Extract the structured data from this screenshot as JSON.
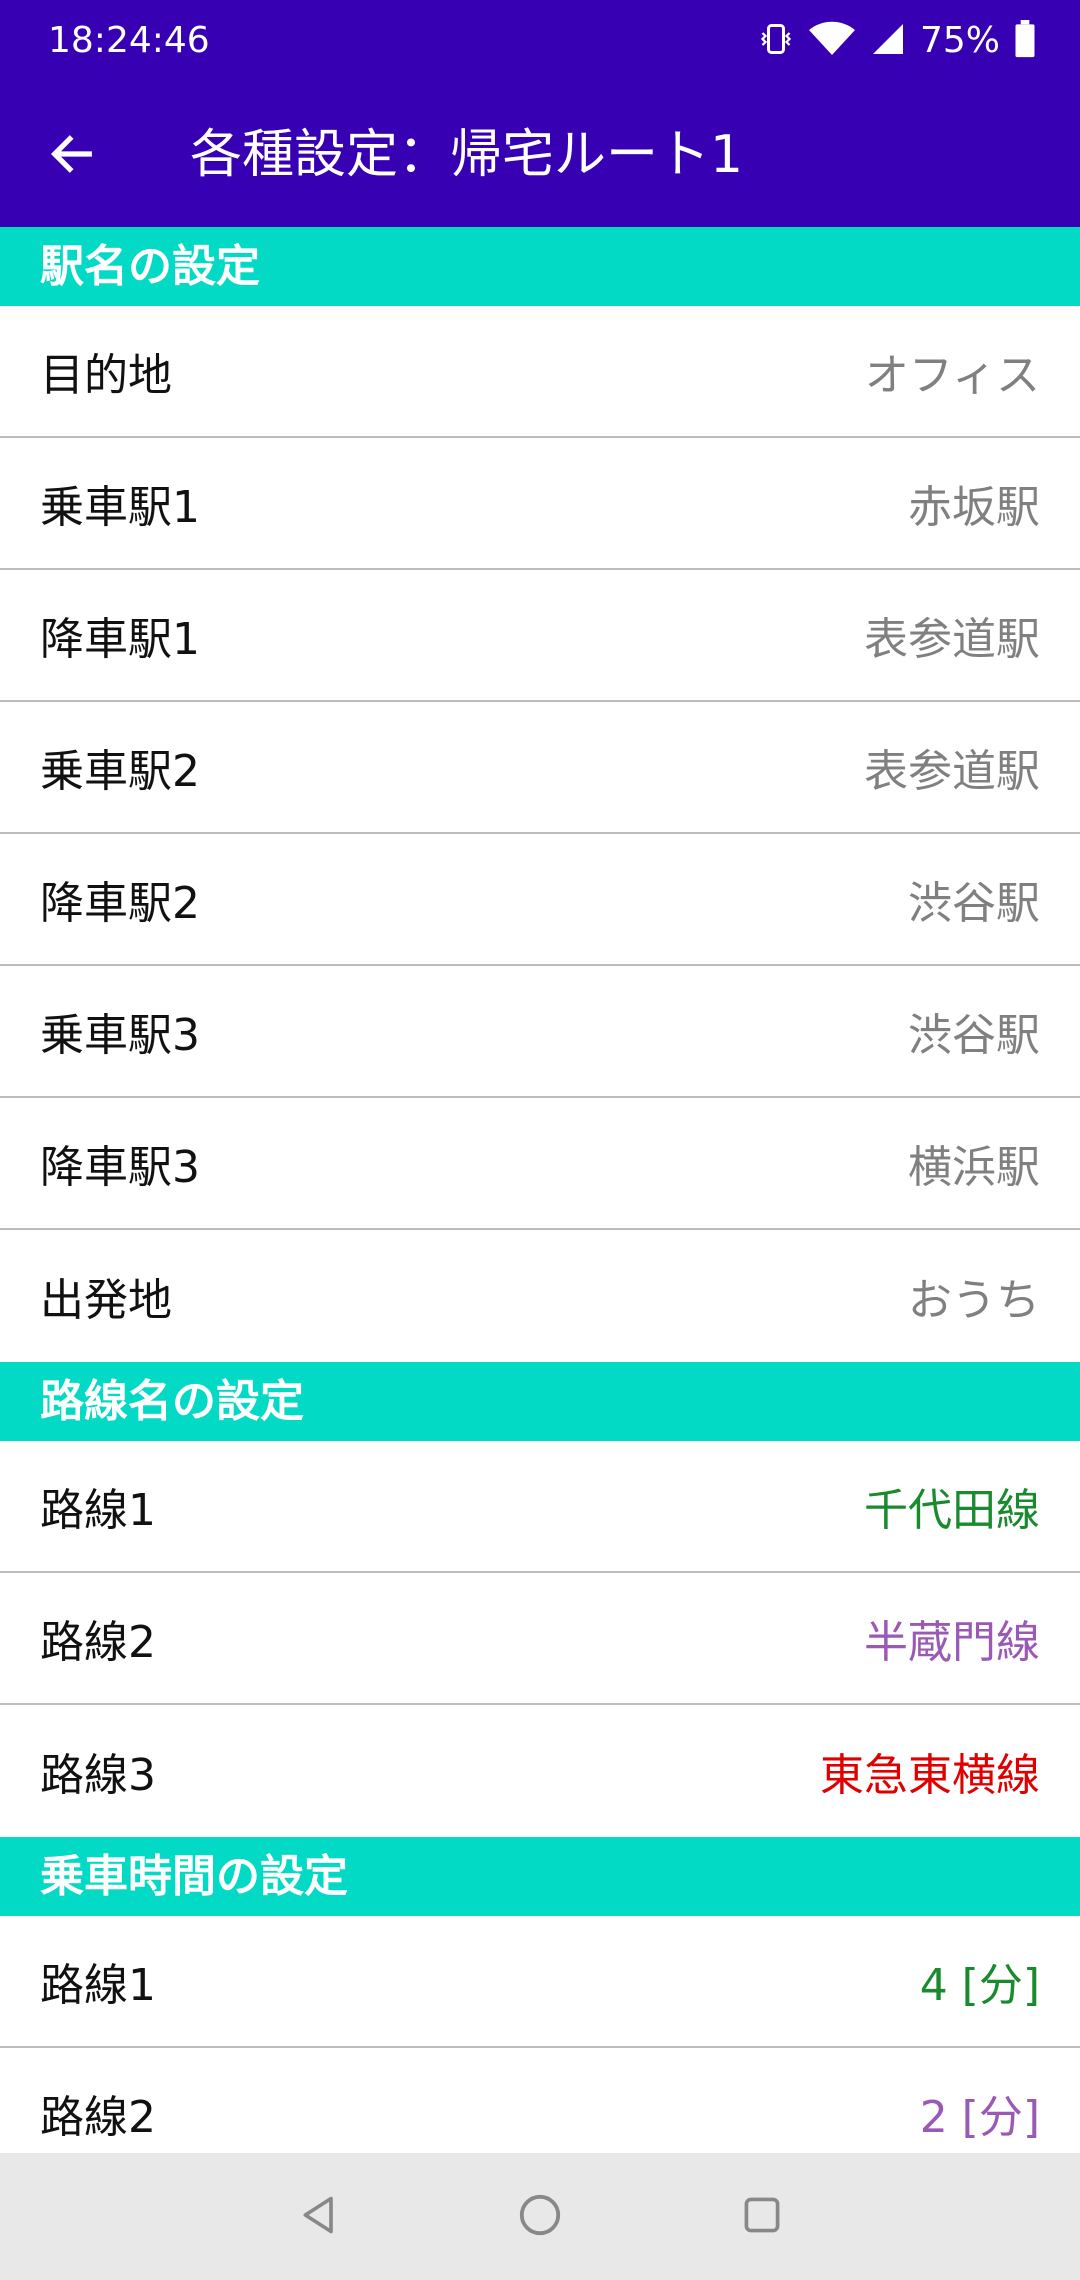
{
  "status_bar": {
    "time": "18:24:46",
    "battery_percent": "75%",
    "icons": [
      "vibrate-icon",
      "wifi-icon",
      "signal-icon",
      "battery-icon"
    ]
  },
  "app_bar": {
    "title": "各種設定：帰宅ルート1",
    "back_icon": "arrow-left-icon"
  },
  "colors": {
    "primary": "#3700b3",
    "section_header": "#03dac5",
    "value_gray": "#808080",
    "line1": "#1a8a2e",
    "line2": "#9b59b6",
    "line3": "#e00000"
  },
  "sections": [
    {
      "title": "駅名の設定",
      "rows": [
        {
          "label": "目的地",
          "value": "オフィス"
        },
        {
          "label": "乗車駅1",
          "value": "赤坂駅"
        },
        {
          "label": "降車駅1",
          "value": "表参道駅"
        },
        {
          "label": "乗車駅2",
          "value": "表参道駅"
        },
        {
          "label": "降車駅2",
          "value": "渋谷駅"
        },
        {
          "label": "乗車駅3",
          "value": "渋谷駅"
        },
        {
          "label": "降車駅3",
          "value": "横浜駅"
        },
        {
          "label": "出発地",
          "value": "おうち"
        }
      ]
    },
    {
      "title": "路線名の設定",
      "rows": [
        {
          "label": "路線1",
          "value": "千代田線"
        },
        {
          "label": "路線2",
          "value": "半蔵門線"
        },
        {
          "label": "路線3",
          "value": "東急東横線"
        }
      ]
    },
    {
      "title": "乗車時間の設定",
      "rows": [
        {
          "label": "路線1",
          "value": "4 [分]"
        },
        {
          "label": "路線2",
          "value": "2 [分]"
        }
      ]
    }
  ],
  "nav_bar": {
    "icons": [
      "back-triangle-icon",
      "home-circle-icon",
      "recents-square-icon"
    ]
  }
}
